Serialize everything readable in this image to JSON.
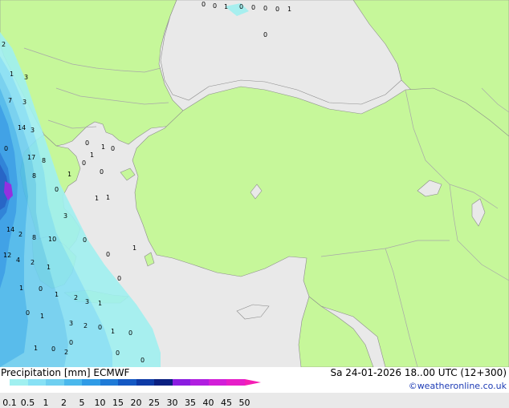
{
  "legend": {
    "title_left": "Precipitation [mm]  ECMWF",
    "title_right": "Sa 24-01-2026 18..00 UTC (12+300)",
    "credit": "©weatheronline.co.uk",
    "scale_values": [
      "0.1",
      "0.5",
      "1",
      "2",
      "5",
      "10",
      "15",
      "20",
      "25",
      "30",
      "35",
      "40",
      "45",
      "50"
    ],
    "scale_colors": [
      "#a0f0f0",
      "#87e1f5",
      "#6ecff0",
      "#4ab8ec",
      "#2f9be6",
      "#1e7ad7",
      "#1458c3",
      "#0d3aa6",
      "#0a1f80",
      "#8a1ce0",
      "#b01ee0",
      "#d21ed8",
      "#e61ec8",
      "#f51eb4"
    ]
  },
  "map_colors": {
    "sea": "#e9e9e9",
    "land": "#c6f79a",
    "border": "#a8a8a8",
    "coast": "#8c8c8c"
  },
  "precip_labels": [
    {
      "v": "0"
    },
    {
      "v": "0"
    },
    {
      "v": "1"
    },
    {
      "v": "0"
    },
    {
      "v": "0"
    },
    {
      "v": "0"
    },
    {
      "v": "0"
    },
    {
      "v": "1"
    },
    {
      "v": "0"
    },
    {
      "v": "2"
    },
    {
      "v": "1"
    },
    {
      "v": "3"
    },
    {
      "v": "7"
    },
    {
      "v": "3"
    },
    {
      "v": "14"
    },
    {
      "v": "3"
    },
    {
      "v": "0"
    },
    {
      "v": "17"
    },
    {
      "v": "8"
    },
    {
      "v": "0"
    },
    {
      "v": "1"
    },
    {
      "v": "0"
    },
    {
      "v": "1"
    },
    {
      "v": "0"
    },
    {
      "v": "1"
    },
    {
      "v": "0"
    },
    {
      "v": "8"
    },
    {
      "v": "0"
    },
    {
      "v": "1"
    },
    {
      "v": "1"
    },
    {
      "v": "3"
    },
    {
      "v": "14"
    },
    {
      "v": "2"
    },
    {
      "v": "8"
    },
    {
      "v": "10"
    },
    {
      "v": "0"
    },
    {
      "v": "12"
    },
    {
      "v": "4"
    },
    {
      "v": "2"
    },
    {
      "v": "1"
    },
    {
      "v": "0"
    },
    {
      "v": "1"
    },
    {
      "v": "1"
    },
    {
      "v": "0"
    },
    {
      "v": "1"
    },
    {
      "v": "2"
    },
    {
      "v": "3"
    },
    {
      "v": "1"
    },
    {
      "v": "0"
    },
    {
      "v": "0"
    },
    {
      "v": "1"
    },
    {
      "v": "3"
    },
    {
      "v": "2"
    },
    {
      "v": "0"
    },
    {
      "v": "0"
    },
    {
      "v": "1"
    },
    {
      "v": "0"
    },
    {
      "v": "1"
    },
    {
      "v": "0"
    },
    {
      "v": "2"
    },
    {
      "v": "0"
    },
    {
      "v": "0"
    }
  ]
}
